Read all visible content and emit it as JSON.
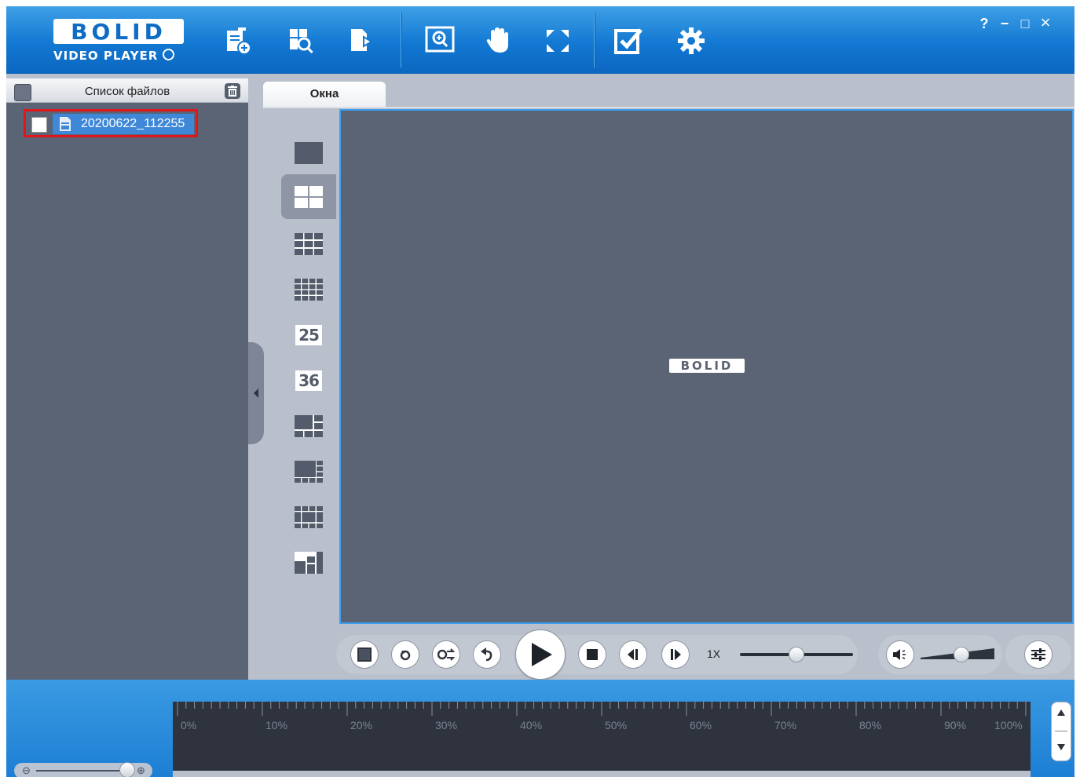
{
  "app": {
    "logo_main": "BOLID",
    "logo_sub": "VIDEO PLAYER",
    "video_logo": "BOLID",
    "colors": {
      "accent": "#1278d2",
      "panel": "#5b6475",
      "highlight": "#e0161b",
      "selection": "#3f88d8"
    }
  },
  "toolbar": {
    "icons": [
      "open-file-icon",
      "search-file-icon",
      "export-icon",
      "zoom-icon",
      "hand-icon",
      "fullscreen-icon",
      "checkbox-icon",
      "settings-icon"
    ]
  },
  "window_controls": {
    "help": "?",
    "minimize": "−",
    "maximize": "□",
    "close": "×"
  },
  "file_list": {
    "title": "Список файлов",
    "items": [
      {
        "name": "20200622_112255"
      }
    ]
  },
  "tabs": [
    {
      "label": "Окна"
    }
  ],
  "layouts": [
    {
      "icon": "layout-1-icon"
    },
    {
      "icon": "layout-4-icon",
      "active": true
    },
    {
      "icon": "layout-9-icon"
    },
    {
      "icon": "layout-16-icon"
    },
    {
      "icon": "layout-25-icon",
      "label": "25"
    },
    {
      "icon": "layout-36-icon",
      "label": "36"
    },
    {
      "icon": "layout-6-icon"
    },
    {
      "icon": "layout-8-icon"
    },
    {
      "icon": "layout-13-icon"
    },
    {
      "icon": "layout-custom-icon"
    }
  ],
  "playback": {
    "speed": "1X",
    "speed_level": 0.5,
    "volume_level": 0.55
  },
  "timeline": {
    "labels": [
      "0%",
      "10%",
      "20%",
      "30%",
      "40%",
      "50%",
      "60%",
      "70%",
      "80%",
      "90%",
      "100%"
    ]
  }
}
